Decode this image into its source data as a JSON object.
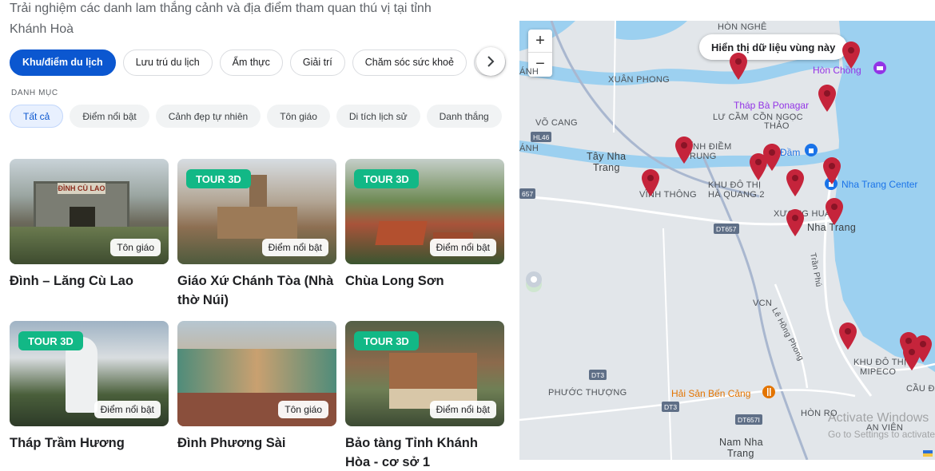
{
  "intro": {
    "line1": "Trải nghiệm các danh lam thắng cảnh và địa điểm tham quan thú vị tại tỉnh",
    "line2": "Khánh Hoà"
  },
  "categories": [
    {
      "label": "Khu/điểm du lịch",
      "active": true
    },
    {
      "label": "Lưu trú du lịch",
      "active": false
    },
    {
      "label": "Ẩm thực",
      "active": false
    },
    {
      "label": "Giải trí",
      "active": false
    },
    {
      "label": "Chăm sóc sức khoẻ",
      "active": false
    }
  ],
  "subcategory_label": "DANH MỤC",
  "subcategories": [
    {
      "label": "Tất cả",
      "active": true
    },
    {
      "label": "Điểm nổi bật",
      "active": false
    },
    {
      "label": "Cảnh đẹp tự nhiên",
      "active": false
    },
    {
      "label": "Tôn giáo",
      "active": false
    },
    {
      "label": "Di tích lịch sử",
      "active": false
    },
    {
      "label": "Danh thắng",
      "active": false
    }
  ],
  "cards": [
    {
      "title": "Đình – Lăng Cù Lao",
      "tag": "Tôn giáo",
      "tour3d": false
    },
    {
      "title": "Giáo Xứ Chánh Tòa (Nhà thờ Núi)",
      "tag": "Điểm nổi bật",
      "tour3d": true
    },
    {
      "title": "Chùa Long Sơn",
      "tag": "Điểm nổi bật",
      "tour3d": true
    },
    {
      "title": "Tháp Trầm Hương",
      "tag": "Điểm nổi bật",
      "tour3d": true
    },
    {
      "title": "Đình Phương Sài",
      "tag": "Tôn giáo",
      "tour3d": false
    },
    {
      "title": "Bảo tàng Tỉnh Khánh Hòa - cơ sở 1",
      "tag": "Điểm nổi bật",
      "tour3d": true
    }
  ],
  "tour3d_label": "TOUR 3D",
  "sign_text": "ĐÌNH CÙ LAO",
  "map": {
    "zoom_in": "+",
    "zoom_out": "−",
    "area_button": "Hiển thị dữ liệu vùng này",
    "labels": {
      "hon_nghe": "HÒN NGHÊ",
      "xuan_phong": "XUÂN PHONG",
      "vo_cang": "VÕ CANG",
      "tay_nha_trang_1": "Tây Nha",
      "tay_nha_trang_2": "Trang",
      "luu_cam": "LƯ CẦM",
      "con_ngoc_thao": "CỒN NGỌC",
      "thao": "THẢO",
      "hon_chong": "Hòn Chồng",
      "thap_ba": "Tháp Bà Ponagar",
      "dam": "Đầm",
      "nha_trang_center": "Nha Trang Center",
      "khu_do_thi": "KHU ĐÔ THỊ",
      "ha_quang": "HÀ QUANG 2",
      "xuong_huan": "XƯƠNG HUÂN",
      "nha_trang": "Nha Trang",
      "vinh_diem": "VĨNH ĐIỀM",
      "trung": "TRUNG",
      "vinh_thong": "VĨNH THÔNG",
      "tran_phu": "Trần Phú",
      "vcn": "VCN",
      "le_hong_phong": "Lê Hồng Phong",
      "khu_do_thi_mipeco_1": "KHU ĐÔ THỊ",
      "khu_do_thi_mipeco_2": "MIPECO",
      "cau_da": "CẦU ĐÁ",
      "phuoc_thuong": "PHƯỚC THƯỢNG",
      "hai_san": "Hải Sản Bến Cảng",
      "hon_ro": "HÒN RỌ",
      "an_vien": "AN VIÊN",
      "nam_nha_trang_1": "Nam Nha",
      "nam_nha_trang_2": "Trang",
      "anh": "ÁNH"
    },
    "shields": {
      "hl46": "HL46",
      "dt657a": "657",
      "dt657b": "DT657",
      "dt3a": "DT3",
      "dt3b": "DT3",
      "dt657c": "DT657I"
    },
    "watermark_1": "Activate Windows",
    "watermark_2": "Go to Settings to activate"
  },
  "colors": {
    "accent": "#0b57d0",
    "tour_badge": "#12b886",
    "pin": "#c5243b",
    "water": "#9cd0f0",
    "land": "#e2e6ea"
  }
}
